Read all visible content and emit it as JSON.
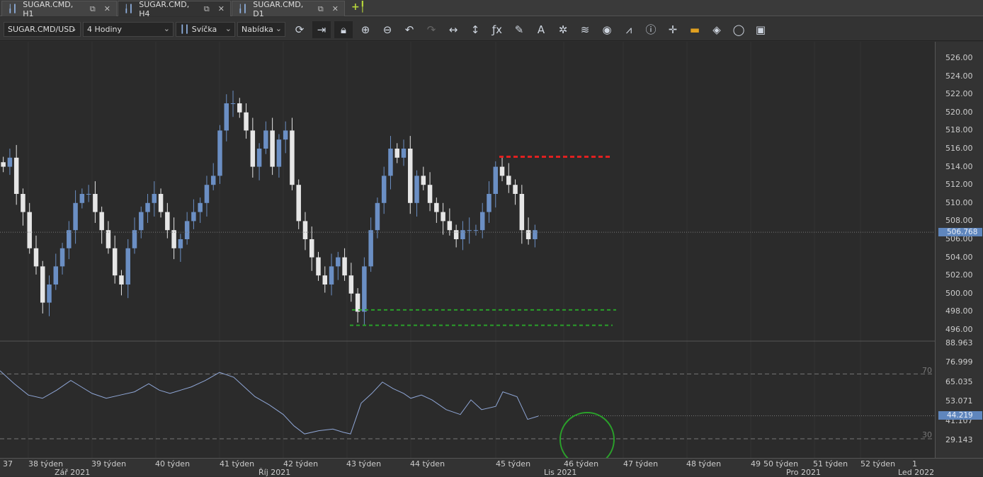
{
  "tabs": [
    {
      "label": "SUGAR.CMD, H1",
      "active": false
    },
    {
      "label": "SUGAR.CMD, H4",
      "active": true
    },
    {
      "label": "SUGAR.CMD, D1",
      "active": false
    }
  ],
  "toolbar": {
    "symbol": "SUGAR.CMD/USD",
    "timeframe": "4 Hodiny",
    "chart_type": "Svíčka",
    "price_type": "Nabídka",
    "icons": [
      "refresh-icon",
      "autoscroll-icon",
      "lock-icon",
      "zoom-in-icon",
      "zoom-out-icon",
      "undo-icon",
      "redo-icon",
      "horizontal-scale-icon",
      "vertical-scale-icon",
      "fx-indicator-icon",
      "pencil-icon",
      "text-icon",
      "crosshair-icon",
      "layers-icon",
      "eye-icon",
      "chart-compare-icon",
      "info-icon",
      "cursor-icon",
      "color-bar-icon",
      "paint-bucket-icon",
      "circle-icon",
      "save-icon"
    ]
  },
  "price_axis": {
    "labels": [
      "526.00",
      "524.00",
      "522.00",
      "520.00",
      "518.00",
      "516.00",
      "514.00",
      "512.00",
      "510.00",
      "508.00",
      "506.00",
      "504.00",
      "502.00",
      "500.00",
      "498.00",
      "496.00"
    ],
    "current": "506.768",
    "current_value": 506.768
  },
  "rsi_axis": {
    "labels": [
      "88.963",
      "76.999",
      "65.035",
      "53.071",
      "41.107",
      "29.143"
    ],
    "current": "44.219",
    "current_value": 44.219,
    "level_high": "70",
    "level_low": "30"
  },
  "weeks": [
    "37",
    "38 týden",
    "39 týden",
    "40 týden",
    "41 týden",
    "42 týden",
    "43 týden",
    "44 týden",
    "45 týden",
    "46 týden",
    "47 týden",
    "48 týden",
    "49",
    "50 týden",
    "51 týden",
    "52 týden",
    "1"
  ],
  "months": [
    "Zář 2021",
    "Říj 2021",
    "Lis 2021",
    "Pro 2021",
    "Led 2022"
  ],
  "colors": {
    "bull": "#6b8fc4",
    "bear": "#e6e6e6",
    "resistance": "#e02020",
    "support": "#2aa02a",
    "rsi": "#8fa6d6"
  },
  "levels": {
    "resistance": 515.1,
    "support_upper": 498.2,
    "support_lower": 496.5
  },
  "chart_data": {
    "type": "candlestick",
    "closes": [
      514,
      515,
      511,
      509,
      505,
      503,
      499,
      501,
      503,
      505,
      507,
      510,
      511,
      511,
      509,
      507,
      505,
      502,
      501,
      505,
      507,
      509,
      510,
      511,
      509,
      507,
      505,
      506,
      508,
      509,
      510,
      512,
      513,
      518,
      521,
      521,
      520,
      518,
      514,
      516,
      518,
      514,
      517,
      518,
      512,
      508,
      506,
      504,
      502,
      501,
      503,
      504,
      502,
      500,
      498,
      503,
      507,
      510,
      513,
      516,
      515,
      516,
      510,
      513,
      512,
      510,
      509,
      508,
      507,
      506,
      507,
      507,
      507,
      509,
      511,
      514,
      513,
      512,
      511,
      507,
      506,
      507
    ],
    "rsi": [
      [
        0,
        72
      ],
      [
        20,
        64
      ],
      [
        40,
        57
      ],
      [
        60,
        55
      ],
      [
        80,
        60
      ],
      [
        100,
        66
      ],
      [
        115,
        62
      ],
      [
        130,
        58
      ],
      [
        150,
        55
      ],
      [
        170,
        57
      ],
      [
        190,
        59
      ],
      [
        210,
        64
      ],
      [
        225,
        60
      ],
      [
        240,
        58
      ],
      [
        255,
        60
      ],
      [
        270,
        62
      ],
      [
        290,
        66
      ],
      [
        310,
        71
      ],
      [
        330,
        68
      ],
      [
        345,
        62
      ],
      [
        360,
        56
      ],
      [
        380,
        51
      ],
      [
        400,
        45
      ],
      [
        415,
        38
      ],
      [
        430,
        33
      ],
      [
        450,
        35
      ],
      [
        470,
        36
      ],
      [
        485,
        34
      ],
      [
        495,
        33
      ],
      [
        510,
        52
      ],
      [
        525,
        58
      ],
      [
        540,
        65
      ],
      [
        555,
        61
      ],
      [
        570,
        58
      ],
      [
        580,
        55
      ],
      [
        595,
        57
      ],
      [
        610,
        54
      ],
      [
        630,
        48
      ],
      [
        650,
        45
      ],
      [
        665,
        54
      ],
      [
        680,
        48
      ],
      [
        700,
        50
      ],
      [
        710,
        59
      ],
      [
        730,
        56
      ],
      [
        745,
        42
      ],
      [
        760,
        44
      ]
    ]
  }
}
